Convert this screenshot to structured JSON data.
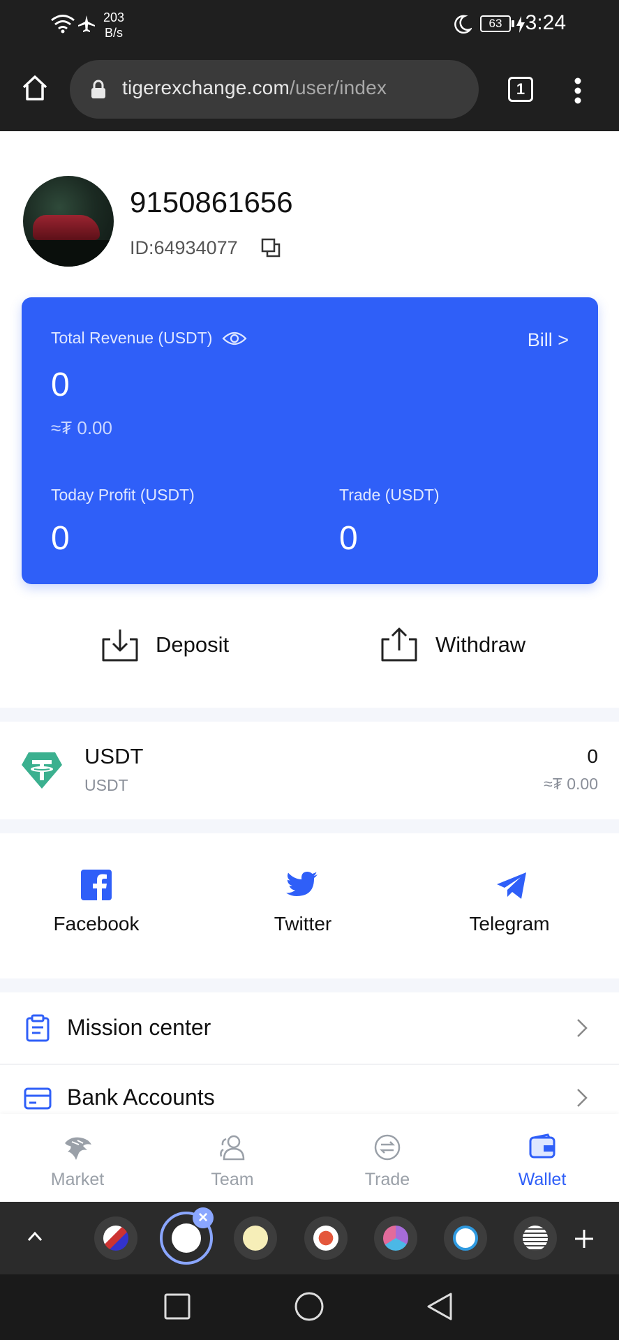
{
  "status_bar": {
    "net_speed_value": "203",
    "net_speed_unit": "B/s",
    "battery": "63",
    "time": "3:24"
  },
  "browser": {
    "url_domain": "tigerexchange.com",
    "url_path": "/user/index",
    "tab_count": "1"
  },
  "profile": {
    "username": "9150861656",
    "user_id": "ID:64934077"
  },
  "revenue_card": {
    "total_label": "Total Revenue (USDT)",
    "total_value": "0",
    "total_fiat": "≈₮ 0.00",
    "bill_label": "Bill >",
    "today_label": "Today Profit (USDT)",
    "today_value": "0",
    "trade_label": "Trade (USDT)",
    "trade_value": "0",
    "card_color": "#2f5ff8"
  },
  "actions": {
    "deposit": "Deposit",
    "withdraw": "Withdraw"
  },
  "assets": [
    {
      "symbol": "USDT",
      "name": "USDT",
      "amount": "0",
      "fiat": "≈₮ 0.00",
      "icon": "tether-icon"
    }
  ],
  "social": {
    "facebook": "Facebook",
    "twitter": "Twitter",
    "telegram": "Telegram"
  },
  "menu": {
    "mission": "Mission center",
    "bank": "Bank Accounts"
  },
  "bottom_nav": {
    "market": "Market",
    "team": "Team",
    "trade": "Trade",
    "wallet": "Wallet",
    "active": "Wallet",
    "accent_color": "#2f5ff8"
  }
}
